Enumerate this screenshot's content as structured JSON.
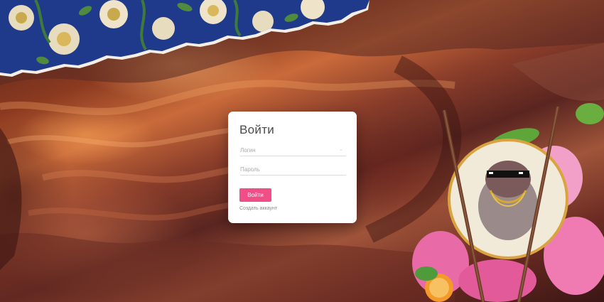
{
  "login_form": {
    "title": "Войти",
    "login_placeholder": "Логин",
    "password_placeholder": "Пароль",
    "submit_label": "Войти",
    "create_account_label": "Создать аккаунт"
  },
  "colors": {
    "accent_button": "#ef4f86",
    "card_background": "#ffffff",
    "title_text": "#4a4a4a",
    "placeholder_text": "#a9a9a9"
  },
  "icons": {
    "field_caret": "chevron-down-icon"
  }
}
